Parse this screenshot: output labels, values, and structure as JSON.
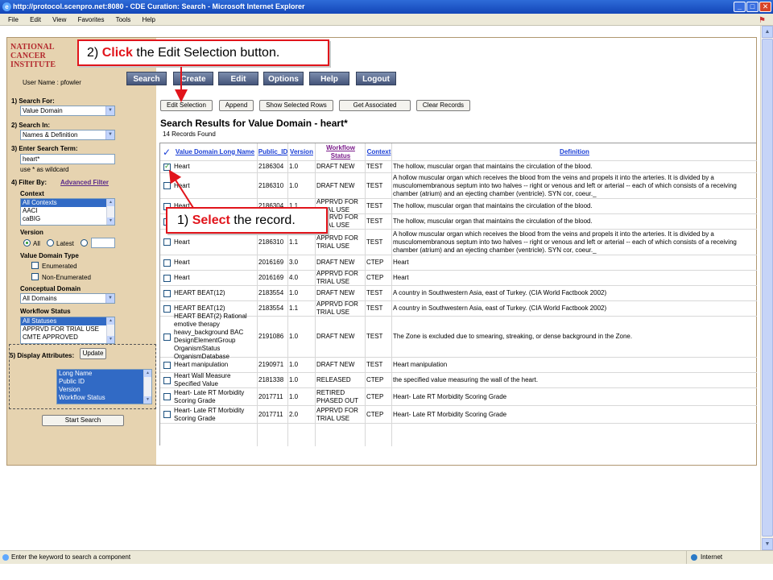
{
  "window": {
    "title": "http://protocol.scenpro.net:8080 - CDE Curation: Search - Microsoft Internet Explorer",
    "buttons": [
      "_",
      "□",
      "✕"
    ]
  },
  "menu": [
    "File",
    "Edit",
    "View",
    "Favorites",
    "Tools",
    "Help"
  ],
  "logo": [
    "NATIONAL",
    "CANCER",
    "INSTITUTE"
  ],
  "user": "User Name : pfowler",
  "nav": [
    "Search",
    "Create",
    "Edit",
    "Options",
    "Help",
    "Logout"
  ],
  "sidebar": {
    "search_for_label": "1) Search For:",
    "search_for_value": "Value Domain",
    "search_in_label": "2) Search In:",
    "search_in_value": "Names & Definition",
    "term_label": "3) Enter Search Term:",
    "term_value": "heart*",
    "wildcard_hint": "use * as wildcard",
    "filter_label": "4) Filter By:",
    "advanced_filter": "Advanced Filter",
    "context_label": "Context",
    "contexts": [
      "All Contexts",
      "AACI",
      "caBIG"
    ],
    "version_label": "Version",
    "version_all": "All",
    "version_latest": "Latest",
    "vd_type_label": "Value Domain Type",
    "enumerated": "Enumerated",
    "non_enumerated": "Non-Enumerated",
    "conceptual_domain_label": "Conceptual Domain",
    "conceptual_domain_value": "All Domains",
    "workflow_label": "Workflow Status",
    "workflow_statuses": [
      "All Statuses",
      "APPRVD FOR TRIAL USE",
      "CMTE APPROVED"
    ],
    "display_attrs_label": "5) Display Attributes:",
    "update_button": "Update",
    "display_attrs": [
      "Long Name",
      "Public ID",
      "Version",
      "Workflow Status"
    ],
    "start_search": "Start Search"
  },
  "toolbar": {
    "edit_selection": "Edit Selection",
    "append": "Append",
    "show_selected": "Show Selected Rows",
    "get_associated": "Get Associated",
    "clear_records": "Clear Records"
  },
  "results": {
    "title": "Search Results for Value Domain - heart*",
    "count": "14 Records Found",
    "headers": {
      "long_name": "Value Domain Long Name",
      "public_id": "Public_ID",
      "version": "Version",
      "workflow": "Workflow Status",
      "context": "Context",
      "definition": "Definition"
    },
    "rows": [
      {
        "checked": true,
        "name": "Heart",
        "id": "2186304",
        "ver": "1.0",
        "status": "DRAFT NEW",
        "ctx": "TEST",
        "def": "The hollow, muscular organ that maintains the circulation of the blood."
      },
      {
        "checked": false,
        "name": "Heart",
        "id": "2186310",
        "ver": "1.0",
        "status": "DRAFT NEW",
        "ctx": "TEST",
        "def": "A hollow muscular organ which receives the blood from the veins and propels it into the arteries. It is divided by a musculomembranous septum into two halves -- right or venous and left or arterial -- each of which consists of a receiving chamber (atrium) and an ejecting chamber (ventricle). SYN cor, coeur._"
      },
      {
        "checked": false,
        "name": "Heart",
        "id": "2186304",
        "ver": "1.1",
        "status": "APPRVD FOR TRIAL USE",
        "ctx": "TEST",
        "def": "The hollow, muscular organ that maintains the circulation of the blood."
      },
      {
        "checked": false,
        "name": "Heart",
        "id": "2186304",
        "ver": "2.0",
        "status": "APPRVD FOR TRIAL USE",
        "ctx": "TEST",
        "def": "The hollow, muscular organ that maintains the circulation of the blood."
      },
      {
        "checked": false,
        "name": "Heart",
        "id": "2186310",
        "ver": "1.1",
        "status": "APPRVD FOR TRIAL USE",
        "ctx": "TEST",
        "def": "A hollow muscular organ which receives the blood from the veins and propels it into the arteries. It is divided by a musculomembranous septum into two halves -- right or venous and left or arterial -- each of which consists of a receiving chamber (atrium) and an ejecting chamber (ventricle). SYN cor, coeur._"
      },
      {
        "checked": false,
        "name": "Heart",
        "id": "2016169",
        "ver": "3.0",
        "status": "DRAFT NEW",
        "ctx": "CTEP",
        "def": "Heart"
      },
      {
        "checked": false,
        "name": "Heart",
        "id": "2016169",
        "ver": "4.0",
        "status": "APPRVD FOR TRIAL USE",
        "ctx": "CTEP",
        "def": "Heart"
      },
      {
        "checked": false,
        "name": "HEART BEAT(12)",
        "id": "2183554",
        "ver": "1.0",
        "status": "DRAFT NEW",
        "ctx": "TEST",
        "def": "A country in Southwestern Asia, east of Turkey. (CIA World Factbook 2002)"
      },
      {
        "checked": false,
        "name": "HEART BEAT(12)",
        "id": "2183554",
        "ver": "1.1",
        "status": "APPRVD FOR TRIAL USE",
        "ctx": "TEST",
        "def": "A country in Southwestern Asia, east of Turkey. (CIA World Factbook 2002)"
      },
      {
        "checked": false,
        "name": "HEART BEAT(2) Rational emotive therapy heavy_background BAC DesignElementGroup OrganismStatus OrganismDatabase",
        "id": "2191086",
        "ver": "1.0",
        "status": "DRAFT NEW",
        "ctx": "TEST",
        "def": "The Zone is excluded due to smearing, streaking, or dense background in the Zone."
      },
      {
        "checked": false,
        "name": "Heart manipulation",
        "id": "2190971",
        "ver": "1.0",
        "status": "DRAFT NEW",
        "ctx": "TEST",
        "def": "Heart manipulation"
      },
      {
        "checked": false,
        "name": "Heart Wall Measure Specified Value",
        "id": "2181338",
        "ver": "1.0",
        "status": "RELEASED",
        "ctx": "CTEP",
        "def": "the specified value measuring the wall of the heart."
      },
      {
        "checked": false,
        "name": "Heart- Late RT Morbidity Scoring Grade",
        "id": "2017711",
        "ver": "1.0",
        "status": "RETIRED PHASED OUT",
        "ctx": "CTEP",
        "def": "Heart- Late RT Morbidity Scoring Grade"
      },
      {
        "checked": false,
        "name": "Heart- Late RT Morbidity Scoring Grade",
        "id": "2017711",
        "ver": "2.0",
        "status": "APPRVD FOR TRIAL USE",
        "ctx": "CTEP",
        "def": "Heart- Late RT Morbidity Scoring Grade"
      }
    ]
  },
  "callouts": {
    "step2_num": "2)",
    "step2_action": "Click",
    "step2_rest": "the Edit Selection button.",
    "step1_num": "1)",
    "step1_action": "Select",
    "step1_rest": "the record."
  },
  "status": {
    "message": "Enter the keyword to search a component",
    "zone": "Internet"
  },
  "colors": {
    "sidebar_bg": "#e6d3b0",
    "nav_button": "#5b6b8c",
    "callout_red": "#e1141b",
    "link_blue": "#1a3fd6"
  }
}
